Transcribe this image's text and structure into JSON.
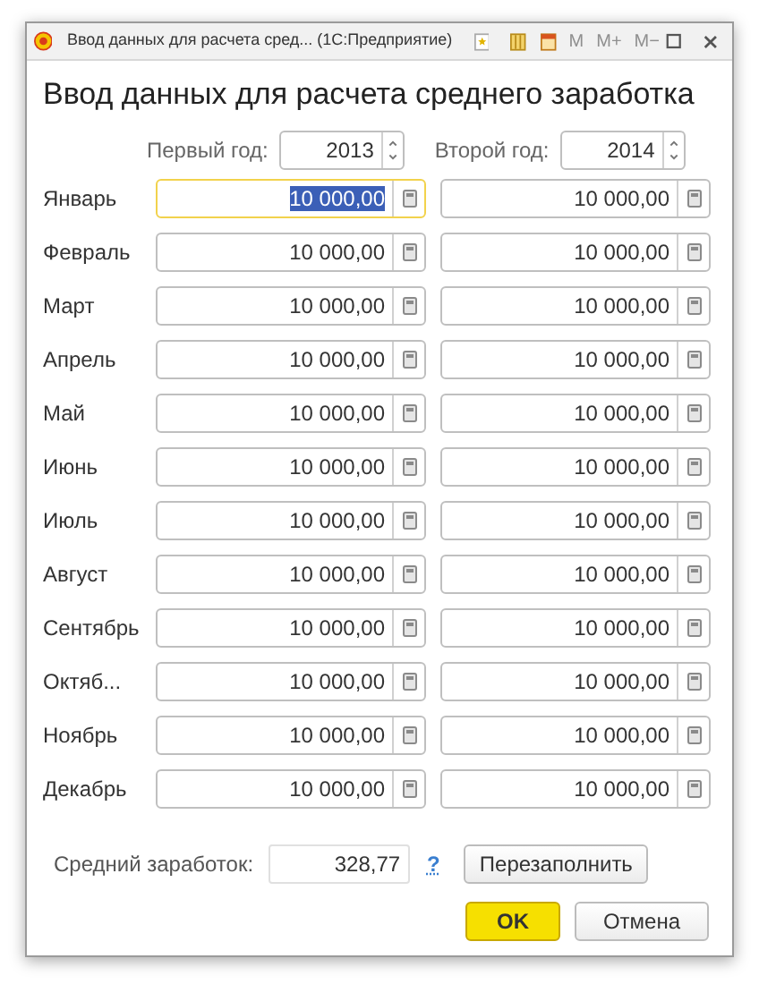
{
  "window": {
    "title": "Ввод данных для расчета сред...  (1С:Предприятие)",
    "memory_buttons": [
      {
        "label": "M",
        "disabled": true
      },
      {
        "label": "M+",
        "disabled": true
      },
      {
        "label": "M−",
        "disabled": true
      }
    ]
  },
  "heading": "Ввод данных для расчета среднего заработка",
  "years": [
    {
      "label": "Первый год:",
      "value": "2013"
    },
    {
      "label": "Второй год:",
      "value": "2014"
    }
  ],
  "months": [
    {
      "label": "Январь",
      "values": [
        {
          "value": "10 000,00",
          "focused": true
        },
        {
          "value": "10 000,00",
          "focused": false
        }
      ]
    },
    {
      "label": "Февраль",
      "values": [
        {
          "value": "10 000,00",
          "focused": false
        },
        {
          "value": "10 000,00",
          "focused": false
        }
      ]
    },
    {
      "label": "Март",
      "values": [
        {
          "value": "10 000,00",
          "focused": false
        },
        {
          "value": "10 000,00",
          "focused": false
        }
      ]
    },
    {
      "label": "Апрель",
      "values": [
        {
          "value": "10 000,00",
          "focused": false
        },
        {
          "value": "10 000,00",
          "focused": false
        }
      ]
    },
    {
      "label": "Май",
      "values": [
        {
          "value": "10 000,00",
          "focused": false
        },
        {
          "value": "10 000,00",
          "focused": false
        }
      ]
    },
    {
      "label": "Июнь",
      "values": [
        {
          "value": "10 000,00",
          "focused": false
        },
        {
          "value": "10 000,00",
          "focused": false
        }
      ]
    },
    {
      "label": "Июль",
      "values": [
        {
          "value": "10 000,00",
          "focused": false
        },
        {
          "value": "10 000,00",
          "focused": false
        }
      ]
    },
    {
      "label": "Август",
      "values": [
        {
          "value": "10 000,00",
          "focused": false
        },
        {
          "value": "10 000,00",
          "focused": false
        }
      ]
    },
    {
      "label": "Сентябрь",
      "values": [
        {
          "value": "10 000,00",
          "focused": false
        },
        {
          "value": "10 000,00",
          "focused": false
        }
      ]
    },
    {
      "label": "Октяб...",
      "values": [
        {
          "value": "10 000,00",
          "focused": false
        },
        {
          "value": "10 000,00",
          "focused": false
        }
      ]
    },
    {
      "label": "Ноябрь",
      "values": [
        {
          "value": "10 000,00",
          "focused": false
        },
        {
          "value": "10 000,00",
          "focused": false
        }
      ]
    },
    {
      "label": "Декабрь",
      "values": [
        {
          "value": "10 000,00",
          "focused": false
        },
        {
          "value": "10 000,00",
          "focused": false
        }
      ]
    }
  ],
  "average": {
    "label": "Средний заработок:",
    "value": "328,77",
    "help": "?",
    "refill_button": "Перезаполнить"
  },
  "buttons": [
    {
      "label": "OK",
      "kind": "primary"
    },
    {
      "label": "Отмена",
      "kind": "secondary"
    }
  ]
}
